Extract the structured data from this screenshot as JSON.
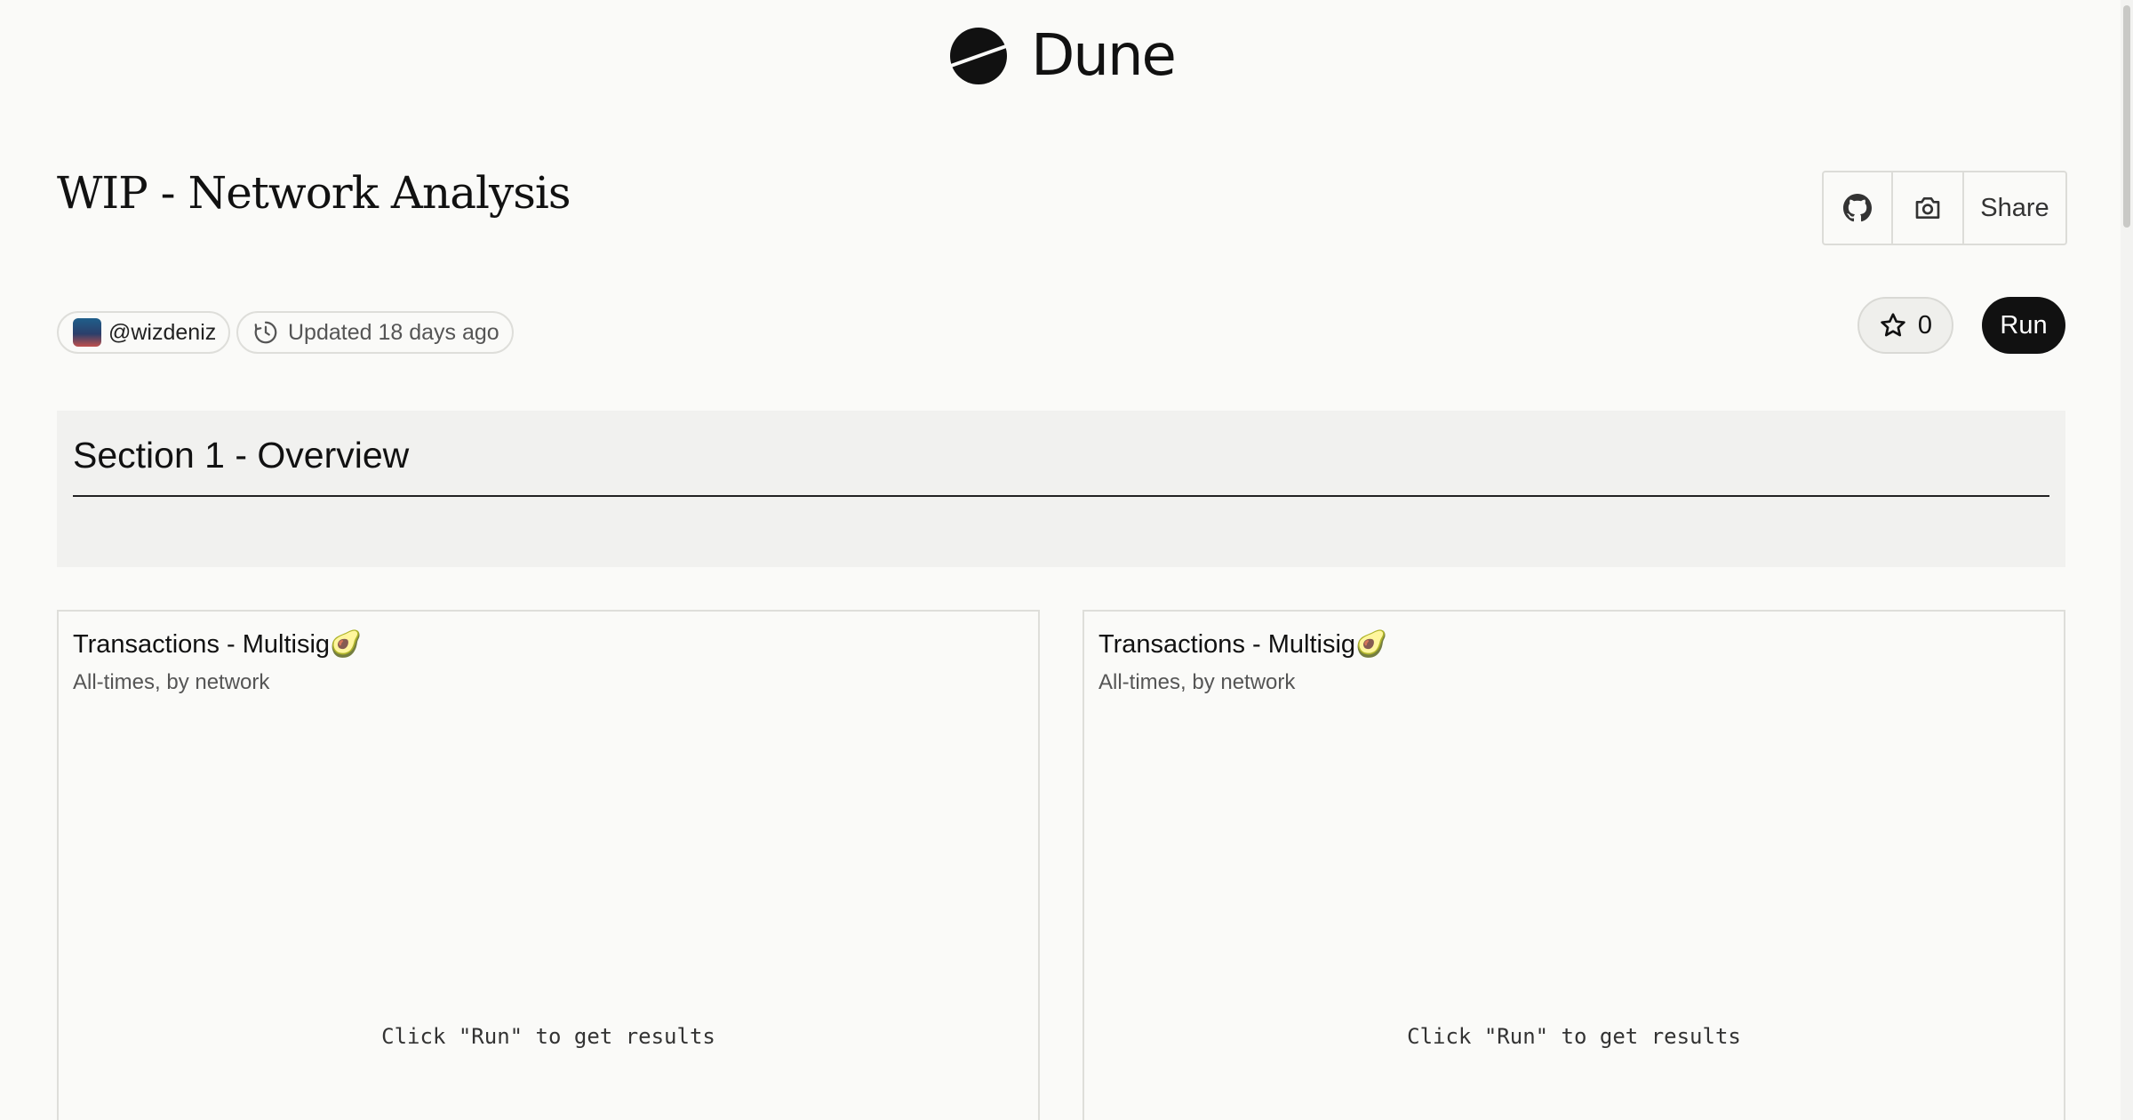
{
  "header": {
    "brand": "Dune",
    "logo_icon": "dune-logo-icon"
  },
  "dashboard": {
    "title": "WIP - Network Analysis"
  },
  "toolbar": {
    "github_icon": "github-icon",
    "camera_icon": "camera-icon",
    "share_label": "Share"
  },
  "meta": {
    "author": "@wizdeniz",
    "updated": "Updated 18 days ago",
    "clock_icon": "clock-icon"
  },
  "actions": {
    "star_count": "0",
    "star_icon": "star-icon",
    "run_label": "Run"
  },
  "section": {
    "title": "Section 1 - Overview"
  },
  "cards": [
    {
      "title": "Transactions - Multisig🥑",
      "subtitle": "All-times, by network",
      "placeholder": "Click \"Run\" to get results"
    },
    {
      "title": "Transactions - Multisig🥑",
      "subtitle": "All-times, by network",
      "placeholder": "Click \"Run\" to get results"
    }
  ],
  "colors": {
    "background": "#fafaf8",
    "section_bg": "#f1f1ef",
    "run_button": "#111111",
    "border": "#dededa"
  }
}
